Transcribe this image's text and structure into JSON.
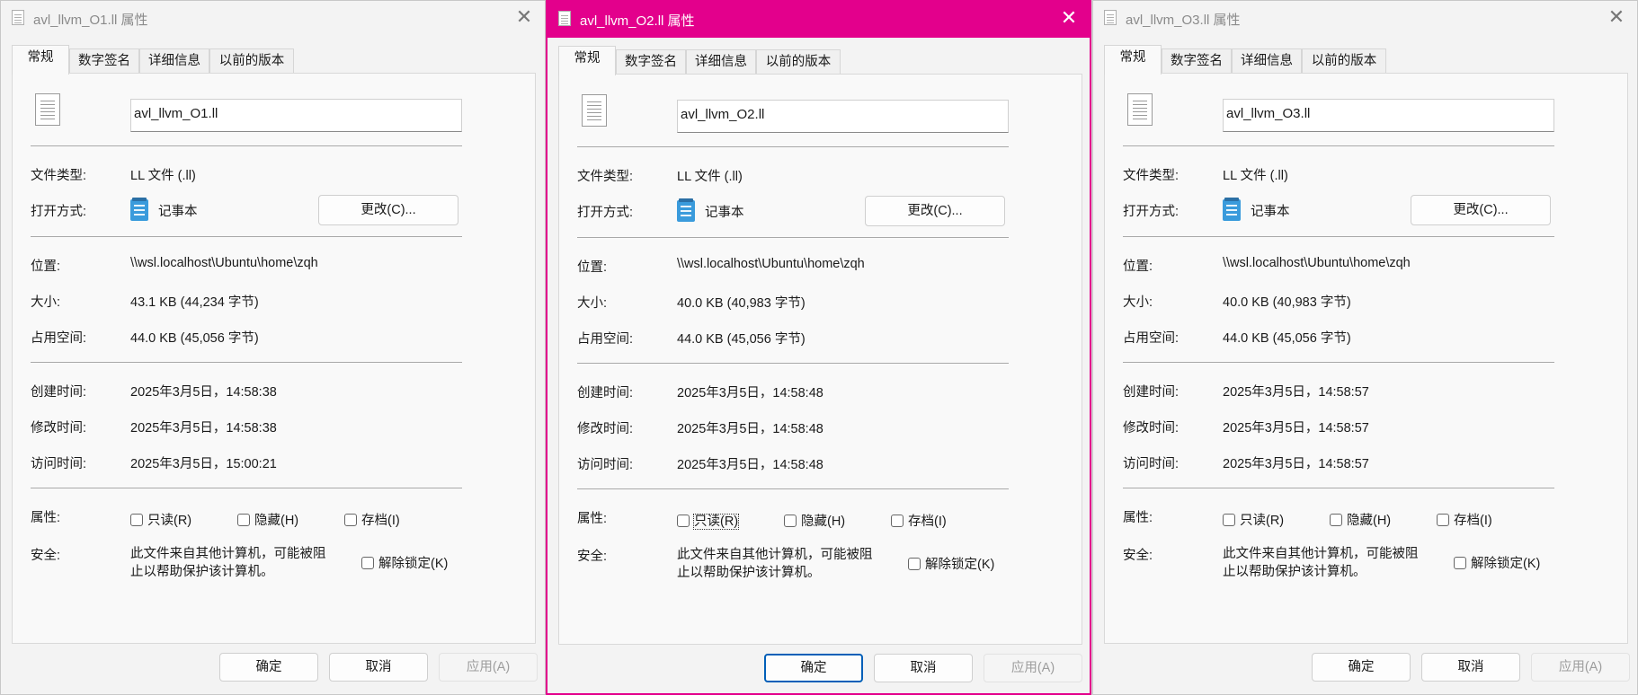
{
  "windows": [
    {
      "title": "avl_llvm_O1.ll 属性",
      "active": false,
      "tabs": [
        "常规",
        "数字签名",
        "详细信息",
        "以前的版本"
      ],
      "filename": "avl_llvm_O1.ll",
      "type_label": "文件类型:",
      "type_value": "LL 文件 (.ll)",
      "open_label": "打开方式:",
      "open_app": "记事本",
      "change_button": "更改(C)...",
      "location_label": "位置:",
      "location_value": "\\\\wsl.localhost\\Ubuntu\\home\\zqh",
      "size_label": "大小:",
      "size_value": "43.1 KB (44,234 字节)",
      "disk_label": "占用空间:",
      "disk_value": "44.0 KB (45,056 字节)",
      "created_label": "创建时间:",
      "created_value": "2025年3月5日，14:58:38",
      "modified_label": "修改时间:",
      "modified_value": "2025年3月5日，14:58:38",
      "accessed_label": "访问时间:",
      "accessed_value": "2025年3月5日，15:00:21",
      "attr_label": "属性:",
      "readonly": "只读(R)",
      "hidden": "隐藏(H)",
      "archive": "存档(I)",
      "security_label": "安全:",
      "security_text": "此文件来自其他计算机，可能被阻止以帮助保护该计算机。",
      "unblock": "解除锁定(K)",
      "ok": "确定",
      "cancel": "取消",
      "apply": "应用(A)"
    },
    {
      "title": "avl_llvm_O2.ll 属性",
      "active": true,
      "tabs": [
        "常规",
        "数字签名",
        "详细信息",
        "以前的版本"
      ],
      "filename": "avl_llvm_O2.ll",
      "type_label": "文件类型:",
      "type_value": "LL 文件 (.ll)",
      "open_label": "打开方式:",
      "open_app": "记事本",
      "change_button": "更改(C)...",
      "location_label": "位置:",
      "location_value": "\\\\wsl.localhost\\Ubuntu\\home\\zqh",
      "size_label": "大小:",
      "size_value": "40.0 KB (40,983 字节)",
      "disk_label": "占用空间:",
      "disk_value": "44.0 KB (45,056 字节)",
      "created_label": "创建时间:",
      "created_value": "2025年3月5日，14:58:48",
      "modified_label": "修改时间:",
      "modified_value": "2025年3月5日，14:58:48",
      "accessed_label": "访问时间:",
      "accessed_value": "2025年3月5日，14:58:48",
      "attr_label": "属性:",
      "readonly": "只读(R)",
      "hidden": "隐藏(H)",
      "archive": "存档(I)",
      "security_label": "安全:",
      "security_text": "此文件来自其他计算机，可能被阻止以帮助保护该计算机。",
      "unblock": "解除锁定(K)",
      "ok": "确定",
      "cancel": "取消",
      "apply": "应用(A)"
    },
    {
      "title": "avl_llvm_O3.ll 属性",
      "active": false,
      "tabs": [
        "常规",
        "数字签名",
        "详细信息",
        "以前的版本"
      ],
      "filename": "avl_llvm_O3.ll",
      "type_label": "文件类型:",
      "type_value": "LL 文件 (.ll)",
      "open_label": "打开方式:",
      "open_app": "记事本",
      "change_button": "更改(C)...",
      "location_label": "位置:",
      "location_value": "\\\\wsl.localhost\\Ubuntu\\home\\zqh",
      "size_label": "大小:",
      "size_value": "40.0 KB (40,983 字节)",
      "disk_label": "占用空间:",
      "disk_value": "44.0 KB (45,056 字节)",
      "created_label": "创建时间:",
      "created_value": "2025年3月5日，14:58:57",
      "modified_label": "修改时间:",
      "modified_value": "2025年3月5日，14:58:57",
      "accessed_label": "访问时间:",
      "accessed_value": "2025年3月5日，14:58:57",
      "attr_label": "属性:",
      "readonly": "只读(R)",
      "hidden": "隐藏(H)",
      "archive": "存档(I)",
      "security_label": "安全:",
      "security_text": "此文件来自其他计算机，可能被阻止以帮助保护该计算机。",
      "unblock": "解除锁定(K)",
      "ok": "确定",
      "cancel": "取消",
      "apply": "应用(A)"
    }
  ],
  "colors": {
    "active_title": "#e3008c",
    "primary_button_border": "#005fb8"
  },
  "icons": {
    "close": "close-icon",
    "file": "file-icon",
    "notepad": "notepad-icon"
  }
}
